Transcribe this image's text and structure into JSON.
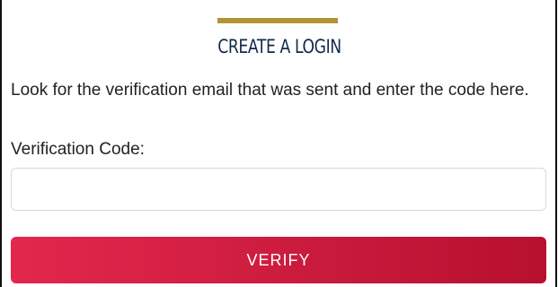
{
  "form": {
    "title": "CREATE A LOGIN",
    "instructions": "Look for the verification email that was sent and enter the code here.",
    "code_label": "Verification Code:",
    "code_value": "",
    "code_placeholder": "",
    "verify_label": "VERIFY"
  },
  "colors": {
    "accent": "#b39336",
    "title": "#13294b",
    "button": "#d41f44"
  }
}
